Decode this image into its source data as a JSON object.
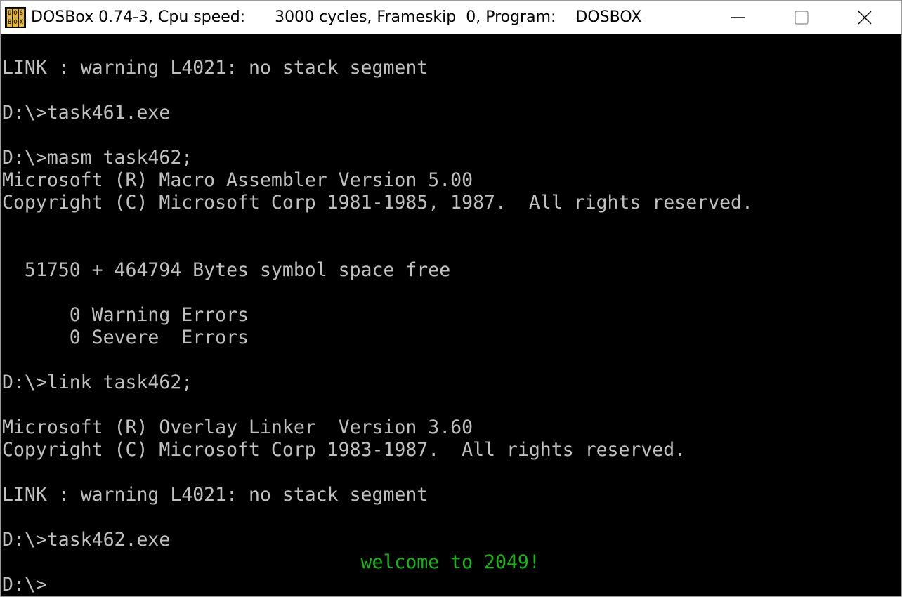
{
  "window": {
    "title": "DOSBox 0.74-3, Cpu speed:      3000 cycles, Frameskip  0, Program:    DOSBOX",
    "icon_text": [
      "D",
      "O",
      "S",
      "B",
      "O",
      "X"
    ],
    "controls": {
      "minimize": "minimize-icon",
      "maximize": "maximize-icon",
      "close": "close-icon"
    }
  },
  "colors": {
    "console_bg": "#000000",
    "console_text": "#c0c0c0",
    "highlight_text": "#14b814",
    "titlebar_bg": "#ffffff"
  },
  "console": {
    "lines": [
      "LINK : warning L4021: no stack segment",
      "",
      "D:\\>task461.exe",
      "",
      "D:\\>masm task462;",
      "Microsoft (R) Macro Assembler Version 5.00",
      "Copyright (C) Microsoft Corp 1981-1985, 1987.  All rights reserved.",
      "",
      "",
      "  51750 + 464794 Bytes symbol space free",
      "",
      "      0 Warning Errors",
      "      0 Severe  Errors",
      "",
      "D:\\>link task462;",
      "",
      "Microsoft (R) Overlay Linker  Version 3.60",
      "Copyright (C) Microsoft Corp 1983-1987.  All rights reserved.",
      "",
      "LINK : warning L4021: no stack segment",
      "",
      "D:\\>task462.exe",
      "                                welcome to 2049!",
      "D:\\>"
    ]
  }
}
